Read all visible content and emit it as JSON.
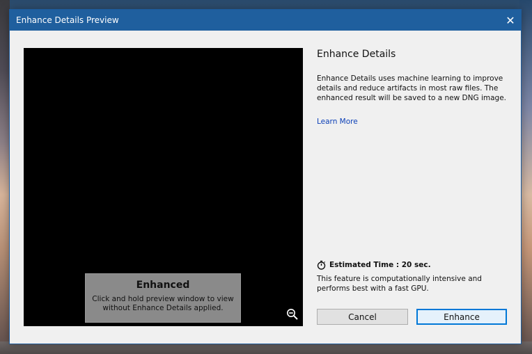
{
  "window": {
    "title": "Enhance Details Preview",
    "close_symbol": "✕"
  },
  "preview": {
    "overlay_title": "Enhanced",
    "overlay_subtitle": "Click and hold preview window to view without Enhance Details applied.",
    "zoom_icon": "zoom-out-icon"
  },
  "panel": {
    "heading": "Enhance Details",
    "description": "Enhance Details uses machine learning to improve details and reduce artifacts in most raw files. The enhanced result will be saved to a new DNG image.",
    "learn_more": "Learn More",
    "timer_icon": "stopwatch-icon",
    "estimated_time": "Estimated Time : 20 sec.",
    "note": "This feature is computationally intensive and performs best with a fast GPU."
  },
  "buttons": {
    "cancel": "Cancel",
    "enhance": "Enhance"
  },
  "colors": {
    "titlebar": "#1f5f9e",
    "accent": "#0078d7",
    "link": "#0b3fb7"
  }
}
